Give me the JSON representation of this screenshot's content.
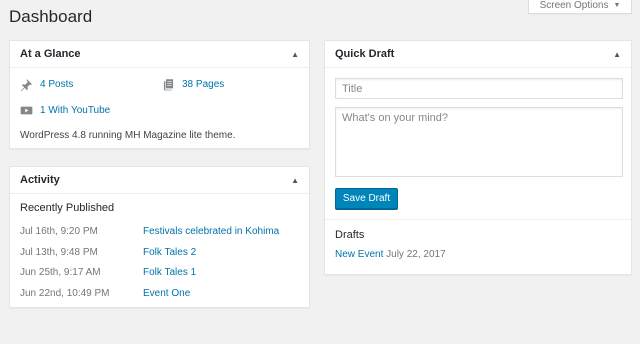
{
  "header": {
    "title": "Dashboard",
    "screen_options_label": "Screen Options",
    "screen_options_caret": "▼"
  },
  "toggle_glyph": "▲",
  "glance": {
    "title": "At a Glance",
    "posts": "4 Posts",
    "pages": "38 Pages",
    "youtube": "1 With YouTube",
    "version_text": "WordPress 4.8 running MH Magazine lite theme.",
    "icons": [
      "pin-icon",
      "pages-icon",
      "youtube-icon"
    ]
  },
  "activity": {
    "title": "Activity",
    "subtitle": "Recently Published",
    "items": [
      {
        "date": "Jul 16th, 9:20 PM",
        "title": "Festivals celebrated in Kohima"
      },
      {
        "date": "Jul 13th, 9:48 PM",
        "title": "Folk Tales 2"
      },
      {
        "date": "Jun 25th, 9:17 AM",
        "title": "Folk Tales 1"
      },
      {
        "date": "Jun 22nd, 10:49 PM",
        "title": "Event One"
      }
    ]
  },
  "quick_draft": {
    "title": "Quick Draft",
    "title_placeholder": "Title",
    "content_placeholder": "What's on your mind?",
    "save_label": "Save Draft",
    "drafts_heading": "Drafts",
    "draft": {
      "title": "New Event",
      "date": "July 22, 2017"
    }
  },
  "colors": {
    "link": "#0073aa",
    "primary_button": "#0085ba",
    "background": "#f1f1f1"
  }
}
